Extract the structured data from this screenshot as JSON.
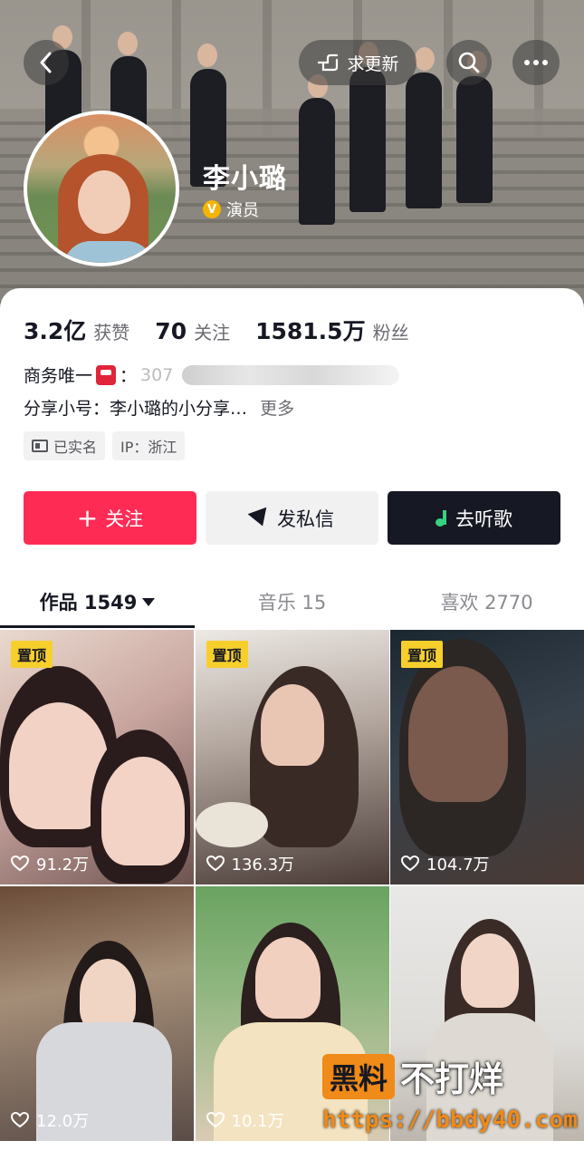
{
  "header": {
    "request_update_label": "求更新",
    "name": "李小璐",
    "verified_badge": "V",
    "role": "演员"
  },
  "stats": {
    "likes_num": "3.2亿",
    "likes_label": "获赞",
    "following_num": "70",
    "following_label": "关注",
    "followers_num": "1581.5万",
    "followers_label": "粉丝"
  },
  "profile": {
    "business_label": "商务唯一",
    "business_colon": "：",
    "business_value_visible": "307",
    "share_line": "分享小号：李小璐的小分享…",
    "more_label": "更多",
    "chip_verified": "已实名",
    "chip_ip": "IP：浙江"
  },
  "actions": {
    "follow": "关注",
    "follow_plus": "+",
    "message": "发私信",
    "listen": "去听歌"
  },
  "tabs": [
    {
      "label": "作品 1549"
    },
    {
      "label": "音乐 15"
    },
    {
      "label": "喜欢 2770"
    }
  ],
  "videos": [
    {
      "pinned": "置顶",
      "likes": "91.2万"
    },
    {
      "pinned": "置顶",
      "likes": "136.3万"
    },
    {
      "pinned": "置顶",
      "likes": "104.7万"
    },
    {
      "pinned": "",
      "likes": "12.0万"
    },
    {
      "pinned": "",
      "likes": "10.1万"
    },
    {
      "pinned": "",
      "likes": ""
    }
  ],
  "watermark": {
    "box": "黑料",
    "text": "不打烊",
    "url": "https://bbdy40.com"
  },
  "colors": {
    "accent": "#fe2c55",
    "pinned_badge": "#f7cf2d",
    "dark_button": "#161823",
    "watermark_orange": "#f08a18"
  }
}
